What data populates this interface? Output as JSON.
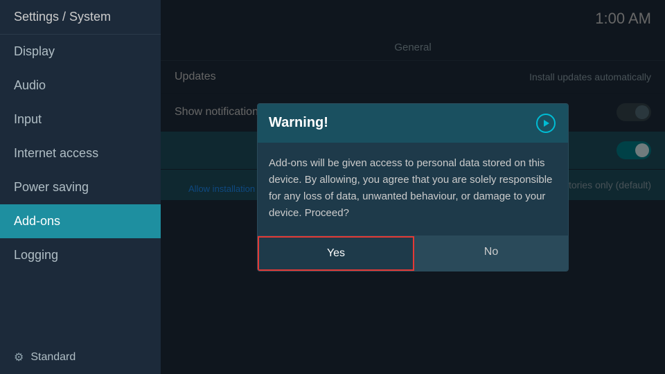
{
  "sidebar": {
    "header": "Settings / System",
    "items": [
      {
        "id": "display",
        "label": "Display",
        "active": false
      },
      {
        "id": "audio",
        "label": "Audio",
        "active": false
      },
      {
        "id": "input",
        "label": "Input",
        "active": false
      },
      {
        "id": "internet-access",
        "label": "Internet access",
        "active": false
      },
      {
        "id": "power-saving",
        "label": "Power saving",
        "active": false
      },
      {
        "id": "add-ons",
        "label": "Add-ons",
        "active": true
      },
      {
        "id": "logging",
        "label": "Logging",
        "active": false
      }
    ],
    "bottom_label": "Standard"
  },
  "topbar": {
    "time": "1:00 AM"
  },
  "main": {
    "section_label": "General",
    "rows": [
      {
        "id": "updates",
        "label": "Updates",
        "value": "Install updates automatically",
        "toggle": null
      },
      {
        "id": "show-notifications",
        "label": "Show notifications",
        "value": null,
        "toggle": "off"
      },
      {
        "id": "unknown-row",
        "label": "",
        "value": null,
        "toggle": "on",
        "highlighted": true
      },
      {
        "id": "repositories",
        "label": "",
        "value": "Official repositories only (default)",
        "highlighted": true
      }
    ],
    "status_text": "Allow installation of add-ons from unknown sources."
  },
  "dialog": {
    "title": "Warning!",
    "body": "Add-ons will be given access to personal data stored on this device. By allowing, you agree that you are solely responsible for any loss of data, unwanted behaviour, or damage to your device. Proceed?",
    "yes_label": "Yes",
    "no_label": "No"
  }
}
